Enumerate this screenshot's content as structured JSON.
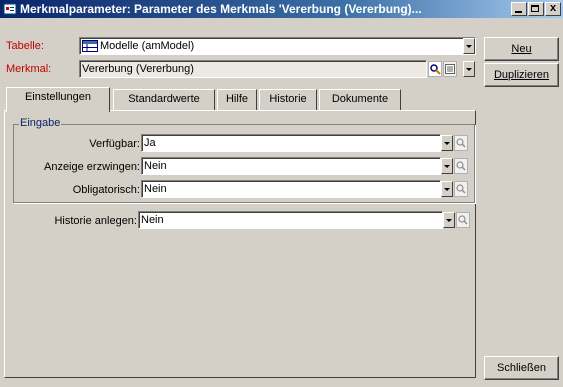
{
  "window": {
    "title": "Merkmalparameter: Parameter des Merkmals 'Vererbung (Vererbung)...",
    "controls": {
      "minimize": "_",
      "maximize": "□",
      "close": "x"
    }
  },
  "header": {
    "tabelle_label": "Tabelle:",
    "tabelle_value": "Modelle (amModel)",
    "merkmal_label": "Merkmal:",
    "merkmal_value": "Vererbung (Vererbung)"
  },
  "buttons": {
    "neu": "Neu",
    "duplizieren": "Duplizieren",
    "schliessen": "Schließen"
  },
  "tabs": [
    {
      "label": "Einstellungen",
      "active": true
    },
    {
      "label": "Standardwerte",
      "active": false
    },
    {
      "label": "Hilfe",
      "active": false
    },
    {
      "label": "Historie",
      "active": false
    },
    {
      "label": "Dokumente",
      "active": false
    }
  ],
  "eingabe": {
    "group_title": "Eingabe",
    "rows": [
      {
        "label": "Verfügbar:",
        "value": "Ja"
      },
      {
        "label": "Anzeige erzwingen:",
        "value": "Nein"
      },
      {
        "label": "Obligatorisch:",
        "value": "Nein"
      }
    ]
  },
  "historie": {
    "label": "Historie anlegen:",
    "value": "Nein"
  },
  "colors": {
    "title_start": "#0a246a",
    "title_end": "#a6caf0",
    "required_label": "#c00000",
    "window_bg": "#d4d0c8"
  }
}
